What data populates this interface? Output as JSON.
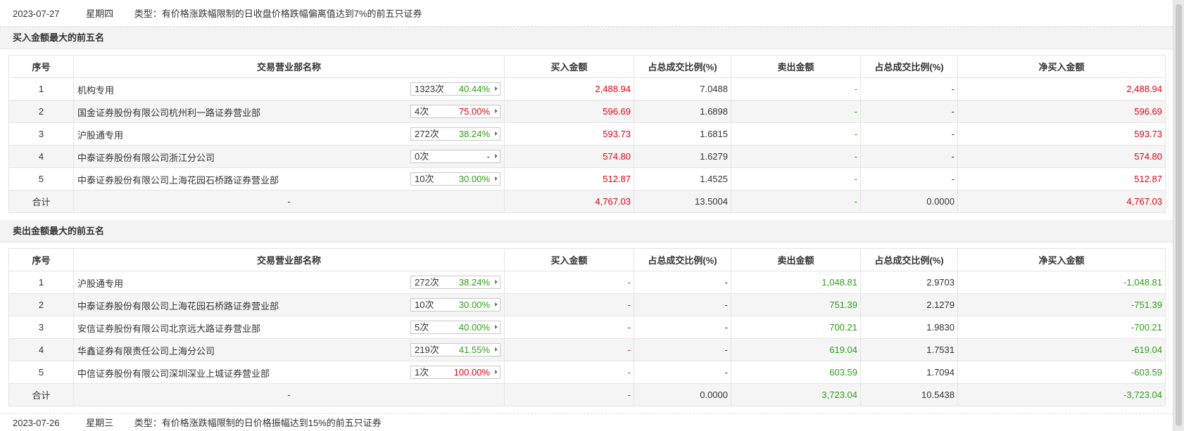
{
  "header": {
    "date": "2023-07-27",
    "weekday": "星期四",
    "type_label": "类型：有价格涨跌幅限制的日收盘价格跌幅偏离值达到7%的前五只证券"
  },
  "colors": {
    "up": "#e60012",
    "down": "#2d9e15"
  },
  "columns": [
    "序号",
    "交易营业部名称",
    "买入金额",
    "占总成交比例(%)",
    "卖出金额",
    "占总成交比例(%)",
    "净买入金额"
  ],
  "buy_section": {
    "title": "买入金额最大的前五名",
    "rows": [
      {
        "idx": "1",
        "name": "机构专用",
        "times": "1323次",
        "rate": "40.44%",
        "rate_color": "green",
        "buy": "2,488.94",
        "buy_pct": "7.0488",
        "sell": "-",
        "sell_pct": "-",
        "net": "2,488.94"
      },
      {
        "idx": "2",
        "name": "国金证券股份有限公司杭州利一路证券营业部",
        "times": "4次",
        "rate": "75.00%",
        "rate_color": "red",
        "buy": "596.69",
        "buy_pct": "1.6898",
        "sell": "-",
        "sell_pct": "-",
        "net": "596.69"
      },
      {
        "idx": "3",
        "name": "沪股通专用",
        "times": "272次",
        "rate": "38.24%",
        "rate_color": "green",
        "buy": "593.73",
        "buy_pct": "1.6815",
        "sell": "-",
        "sell_pct": "-",
        "net": "593.73"
      },
      {
        "idx": "4",
        "name": "中泰证券股份有限公司浙江分公司",
        "times": "0次",
        "rate": "-",
        "rate_color": "gray",
        "buy": "574.80",
        "buy_pct": "1.6279",
        "sell": "-",
        "sell_pct": "-",
        "net": "574.80"
      },
      {
        "idx": "5",
        "name": "中泰证券股份有限公司上海花园石桥路证券营业部",
        "times": "10次",
        "rate": "30.00%",
        "rate_color": "green",
        "buy": "512.87",
        "buy_pct": "1.4525",
        "sell": "-",
        "sell_pct": "-",
        "net": "512.87"
      }
    ],
    "total": {
      "label": "合计",
      "name": "-",
      "buy": "4,767.03",
      "buy_pct": "13.5004",
      "sell": "-",
      "sell_pct": "0.0000",
      "net": "4,767.03"
    }
  },
  "sell_section": {
    "title": "卖出金额最大的前五名",
    "rows": [
      {
        "idx": "1",
        "name": "沪股通专用",
        "times": "272次",
        "rate": "38.24%",
        "rate_color": "green",
        "buy": "-",
        "buy_pct": "-",
        "sell": "1,048.81",
        "sell_pct": "2.9703",
        "net": "-1,048.81"
      },
      {
        "idx": "2",
        "name": "中泰证券股份有限公司上海花园石桥路证券营业部",
        "times": "10次",
        "rate": "30.00%",
        "rate_color": "green",
        "buy": "-",
        "buy_pct": "-",
        "sell": "751.39",
        "sell_pct": "2.1279",
        "net": "-751.39"
      },
      {
        "idx": "3",
        "name": "安信证券股份有限公司北京远大路证券营业部",
        "times": "5次",
        "rate": "40.00%",
        "rate_color": "green",
        "buy": "-",
        "buy_pct": "-",
        "sell": "700.21",
        "sell_pct": "1.9830",
        "net": "-700.21"
      },
      {
        "idx": "4",
        "name": "华鑫证券有限责任公司上海分公司",
        "times": "219次",
        "rate": "41.55%",
        "rate_color": "green",
        "buy": "-",
        "buy_pct": "-",
        "sell": "619.04",
        "sell_pct": "1.7531",
        "net": "-619.04"
      },
      {
        "idx": "5",
        "name": "中信证券股份有限公司深圳深业上城证券营业部",
        "times": "1次",
        "rate": "100.00%",
        "rate_color": "red",
        "buy": "-",
        "buy_pct": "-",
        "sell": "603.59",
        "sell_pct": "1.7094",
        "net": "-603.59"
      }
    ],
    "total": {
      "label": "合计",
      "name": "-",
      "buy": "-",
      "buy_pct": "0.0000",
      "sell": "3,723.04",
      "sell_pct": "10.5438",
      "net": "-3,723.04"
    }
  },
  "next_header": {
    "date": "2023-07-26",
    "weekday": "星期三",
    "type_label": "类型：有价格涨跌幅限制的日价格振幅达到15%的前五只证券"
  }
}
